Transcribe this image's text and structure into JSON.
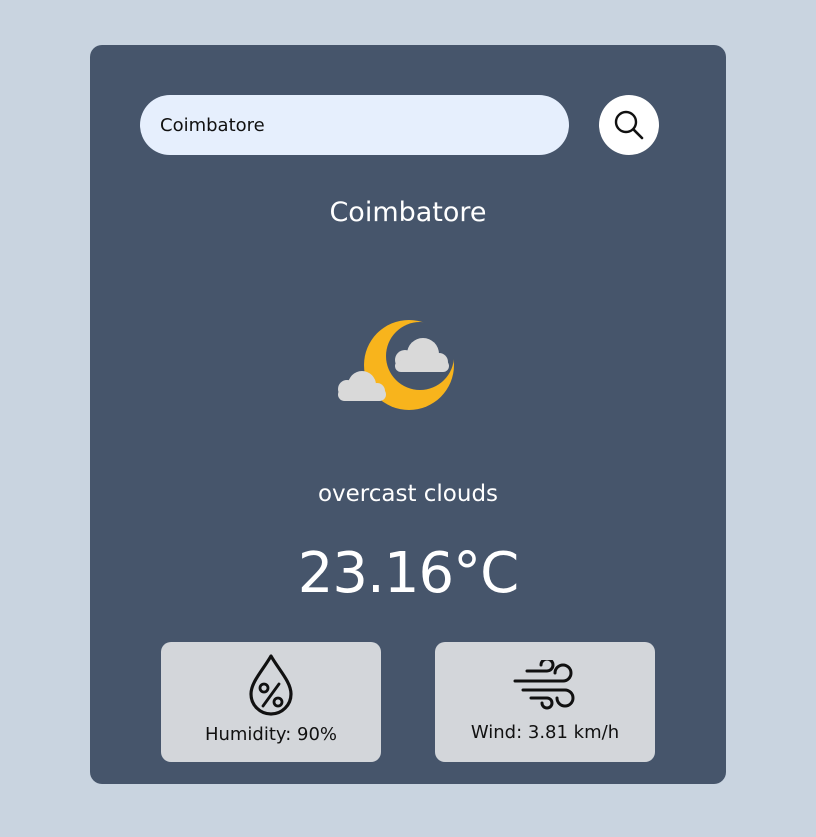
{
  "search": {
    "value": "Coimbatore",
    "button_icon": "search-icon"
  },
  "weather": {
    "city": "Coimbatore",
    "icon": "moon-with-clouds-icon",
    "description": "overcast clouds",
    "temperature": "23.16°C"
  },
  "stats": {
    "humidity": {
      "icon": "humidity-drop-icon",
      "label": "Humidity: 90%"
    },
    "wind": {
      "icon": "wind-icon",
      "label": "Wind: 3.81 km/h"
    }
  },
  "colors": {
    "background": "#c9d4e0",
    "card": "#46556b",
    "input": "#e6effd",
    "stat_box": "#d3d6da",
    "moon": "#f8b41c"
  }
}
